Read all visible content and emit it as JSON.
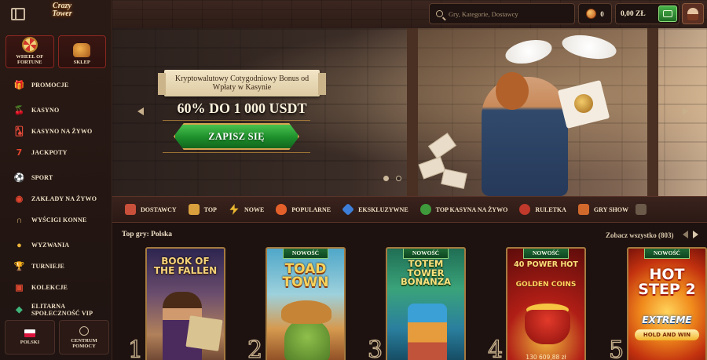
{
  "header": {
    "logo_text": "Crazy Tower",
    "search_placeholder": "Gry, Kategorie, Dostawcy",
    "coins": "0",
    "balance": "0,00 ZŁ"
  },
  "sidebar": {
    "tiles": [
      {
        "label": "WHEEL OF FORTUNE",
        "icon": "wheel-icon"
      },
      {
        "label": "SKLEP",
        "icon": "shop-bag-icon"
      }
    ],
    "items": [
      {
        "label": "PROMOCJE",
        "icon": "gift-icon"
      },
      {
        "label": "KASYNO",
        "icon": "cherry-icon"
      },
      {
        "label": "KASYNO NA ŻYWO",
        "icon": "live-cards-icon"
      },
      {
        "label": "JACKPOTY",
        "icon": "seven-icon"
      },
      {
        "label": "SPORT",
        "icon": "soccer-ball-icon"
      },
      {
        "label": "ZAKŁADY NA ŻYWO",
        "icon": "live-bets-icon"
      },
      {
        "label": "WYŚCIGI KONNE",
        "icon": "horseshoe-icon"
      },
      {
        "label": "WYZWANIA",
        "icon": "medal-icon"
      },
      {
        "label": "TURNIEJE",
        "icon": "trophy-icon"
      },
      {
        "label": "KOLEKCJE",
        "icon": "collection-icon"
      },
      {
        "label": "ELITARNA SPOŁECZNOŚĆ VIP",
        "icon": "diamond-icon"
      }
    ],
    "bottom": [
      {
        "label": "POLSKI",
        "icon": "poland-flag-icon"
      },
      {
        "label": "CENTRUM POMOCY",
        "icon": "help-icon"
      }
    ]
  },
  "hero": {
    "ribbon_text": "Kryptowalutowy Cotygodniowy Bonus od Wpłaty w Kasynie",
    "title": "60% DO 1 000 USDT",
    "cta_label": "ZAPISZ SIĘ",
    "slide_count": 2,
    "active_slide": 1
  },
  "categories": [
    {
      "label": "DOSTAWCY",
      "icon": "providers-icon",
      "color": "#c9503a"
    },
    {
      "label": "TOP",
      "icon": "crown-icon",
      "color": "#d9a03d"
    },
    {
      "label": "NOWE",
      "icon": "lightning-icon",
      "color": "#e9b730"
    },
    {
      "label": "POPULARNE",
      "icon": "fire-icon",
      "color": "#e4602a"
    },
    {
      "label": "EKSKLUZYWNE",
      "icon": "gem-icon",
      "color": "#3d7fd8"
    },
    {
      "label": "TOP KASYNA NA ŻYWO",
      "icon": "live-chip-icon",
      "color": "#3f9a3c"
    },
    {
      "label": "RULETKA",
      "icon": "roulette-icon",
      "color": "#c0392b"
    },
    {
      "label": "GRY SHOW",
      "icon": "show-icon",
      "color": "#d2692c"
    }
  ],
  "top_games": {
    "title": "Top gry: Polska",
    "see_all": "Zobacz wszystko (803)",
    "games": [
      {
        "rank": "1",
        "title": "BOOK OF THE FALLEN",
        "badge": ""
      },
      {
        "rank": "2",
        "title": "TOAD TOWN",
        "badge": "NOWOŚĆ"
      },
      {
        "rank": "3",
        "title": "TOTEM TOWER BONANZA",
        "badge": "NOWOŚĆ"
      },
      {
        "rank": "4",
        "title": "40 POWER HOT",
        "subtitle": "GOLDEN COINS",
        "amount": "130 609,88 zł",
        "badge": "NOWOŚĆ"
      },
      {
        "rank": "5",
        "title": "HOT STEP 2",
        "subtitle": "EXTREME",
        "tag": "HOLD AND WIN",
        "badge": "NOWOŚĆ"
      }
    ]
  },
  "colors": {
    "accent_green": "#1d8e2b",
    "gold_border": "#a57a3f",
    "background": "#1d1210"
  }
}
